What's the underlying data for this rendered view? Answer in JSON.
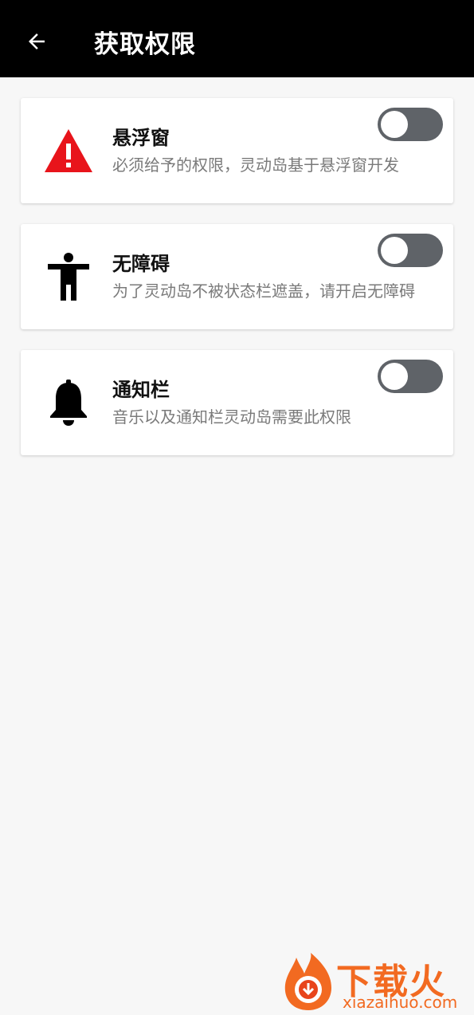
{
  "appbar": {
    "title": "获取权限",
    "back_icon": "arrow-left-icon"
  },
  "permissions": [
    {
      "icon": "warning-icon",
      "title": "悬浮窗",
      "desc": "必须给予的权限，灵动岛基于悬浮窗开发",
      "enabled": false
    },
    {
      "icon": "accessibility-icon",
      "title": "无障碍",
      "desc": "为了灵动岛不被状态栏遮盖，请开启无障碍",
      "enabled": false
    },
    {
      "icon": "bell-icon",
      "title": "通知栏",
      "desc": "音乐以及通知栏灵动岛需要此权限",
      "enabled": false
    }
  ],
  "watermark": {
    "text": "下载火",
    "url": "xiazaihuo.com"
  },
  "colors": {
    "appbar_bg": "#000000",
    "switch_off": "#5f6368",
    "warning": "#e8141b",
    "watermark": "#f26a21"
  }
}
